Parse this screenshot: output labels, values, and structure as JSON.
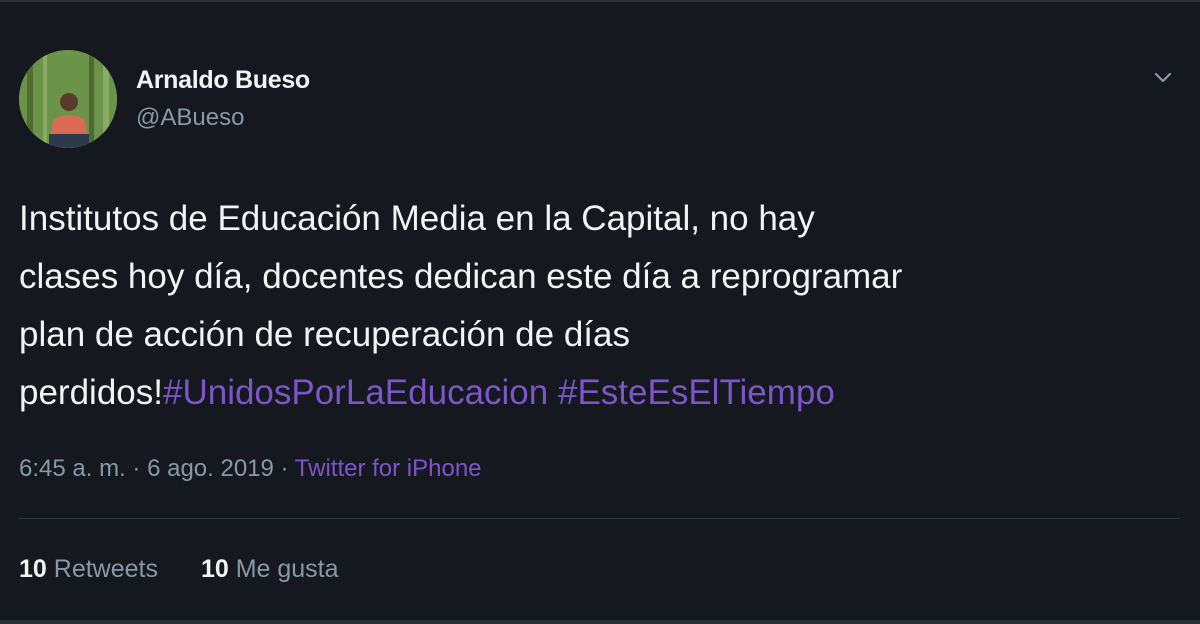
{
  "author": {
    "name": "Arnaldo Bueso",
    "handle": "@ABueso"
  },
  "tweet": {
    "lines": [
      "Institutos de Educación Media en la Capital, no hay",
      "clases hoy día, docentes dedican este día a reprogramar",
      "plan de acción de recuperación de días"
    ],
    "last_line_text": "perdidos!",
    "hashtags": [
      "#UnidosPorLaEducacion",
      "#EsteEsElTiempo"
    ]
  },
  "meta": {
    "time": "6:45 a. m.",
    "separator": "·",
    "date": "6 ago. 2019",
    "source": "Twitter for iPhone"
  },
  "stats": {
    "retweets_count": "10",
    "retweets_label": "Retweets",
    "likes_count": "10",
    "likes_label": "Me gusta"
  },
  "colors": {
    "background": "#15181f",
    "text": "#f2f3f5",
    "secondary_text": "#8899a6",
    "hashtag": "#7c56c8"
  },
  "icons": {
    "menu": "chevron-down-icon"
  }
}
